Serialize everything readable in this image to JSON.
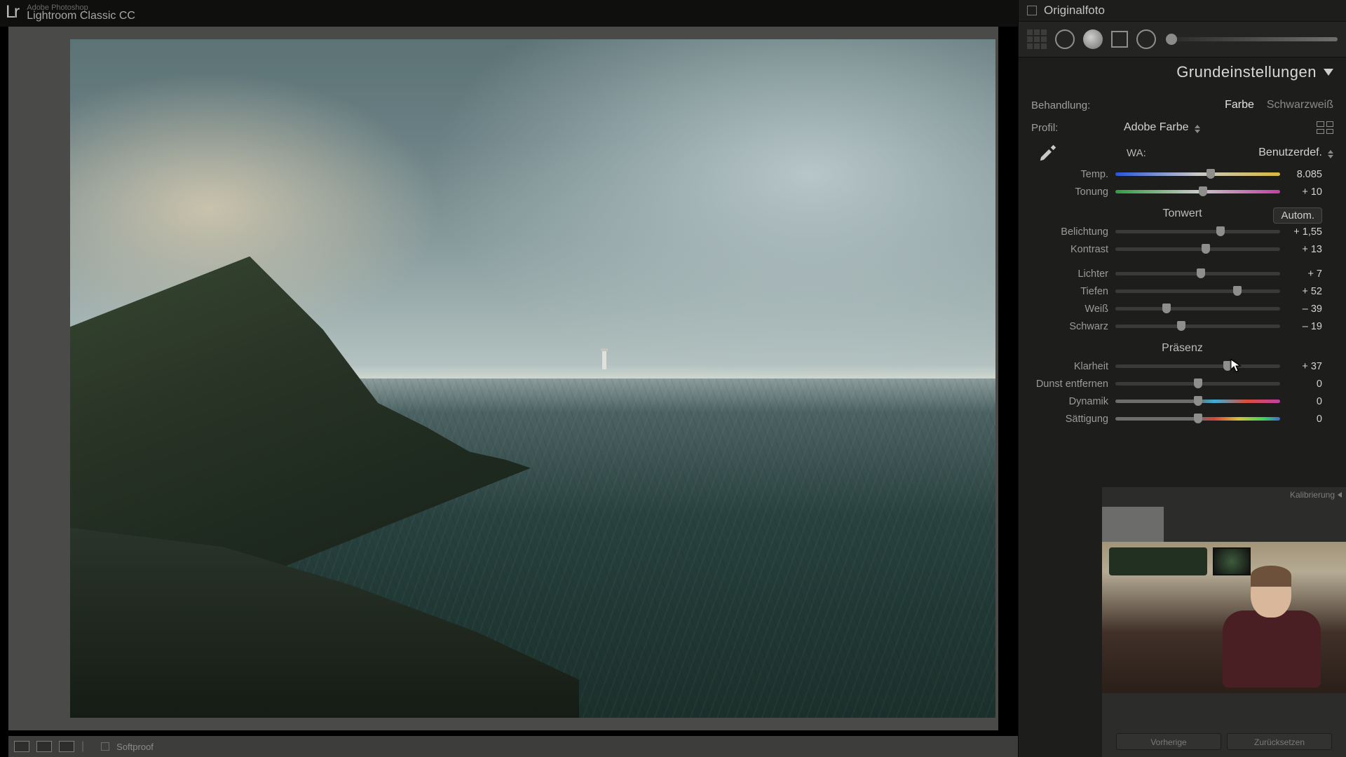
{
  "app": {
    "publisher": "Adobe Photoshop",
    "title": "Lightroom Classic CC",
    "logo": "Lr"
  },
  "originalphoto": {
    "label": "Originalfoto"
  },
  "panel_title": "Grundeinstellungen",
  "treatment": {
    "label": "Behandlung:",
    "color": "Farbe",
    "bw": "Schwarzweiß"
  },
  "profile": {
    "label": "Profil:",
    "value": "Adobe Farbe"
  },
  "wb": {
    "label": "WA:",
    "value": "Benutzerdef."
  },
  "tone_header": "Tonwert",
  "auto_label": "Autom.",
  "presence_header": "Präsenz",
  "sliders": {
    "temp": {
      "name": "Temp.",
      "value": "8.085",
      "pos": 58
    },
    "tint": {
      "name": "Tonung",
      "value": "+ 10",
      "pos": 53
    },
    "exposure": {
      "name": "Belichtung",
      "value": "+ 1,55",
      "pos": 64
    },
    "contrast": {
      "name": "Kontrast",
      "value": "+ 13",
      "pos": 55
    },
    "highlights": {
      "name": "Lichter",
      "value": "+ 7",
      "pos": 52
    },
    "shadows": {
      "name": "Tiefen",
      "value": "+ 52",
      "pos": 74
    },
    "whites": {
      "name": "Weiß",
      "value": "– 39",
      "pos": 31
    },
    "blacks": {
      "name": "Schwarz",
      "value": "– 19",
      "pos": 40
    },
    "clarity": {
      "name": "Klarheit",
      "value": "+ 37",
      "pos": 68
    },
    "dehaze": {
      "name": "Dunst entfernen",
      "value": "0",
      "pos": 50
    },
    "vibrance": {
      "name": "Dynamik",
      "value": "0",
      "pos": 50
    },
    "saturation": {
      "name": "Sättigung",
      "value": "0",
      "pos": 50
    }
  },
  "calibration_label": "Kalibrierung",
  "buttons": {
    "prev": "Vorherige",
    "reset": "Zurücksetzen"
  },
  "bottom": {
    "softproof": "Softproof"
  }
}
